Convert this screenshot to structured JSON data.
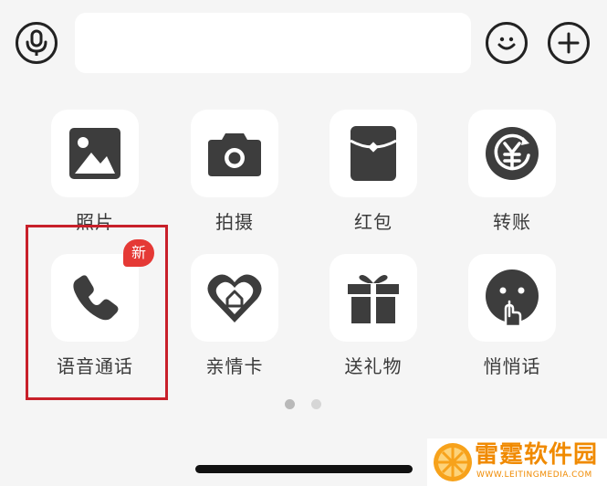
{
  "top_bar": {
    "voice_icon": "microphone-icon",
    "emoji_icon": "smiley-icon",
    "more_icon": "plus-icon",
    "input_value": ""
  },
  "panel": {
    "items": [
      {
        "label": "照片",
        "icon": "photo-icon"
      },
      {
        "label": "拍摄",
        "icon": "camera-icon"
      },
      {
        "label": "红包",
        "icon": "red-packet-icon"
      },
      {
        "label": "转账",
        "icon": "transfer-icon"
      },
      {
        "label": "语音通话",
        "icon": "phone-icon",
        "badge": "新"
      },
      {
        "label": "亲情卡",
        "icon": "family-card-icon"
      },
      {
        "label": "送礼物",
        "icon": "gift-icon"
      },
      {
        "label": "悄悄话",
        "icon": "whisper-icon"
      }
    ],
    "page_count": 2,
    "current_page": 1
  },
  "watermark": {
    "name": "雷霆软件园",
    "url": "WWW.LEITINGMEDIA.COM"
  },
  "colors": {
    "icon": "#3d3d3d",
    "badge": "#e53935",
    "highlight": "#c8202a",
    "watermark": "#f08a00"
  }
}
